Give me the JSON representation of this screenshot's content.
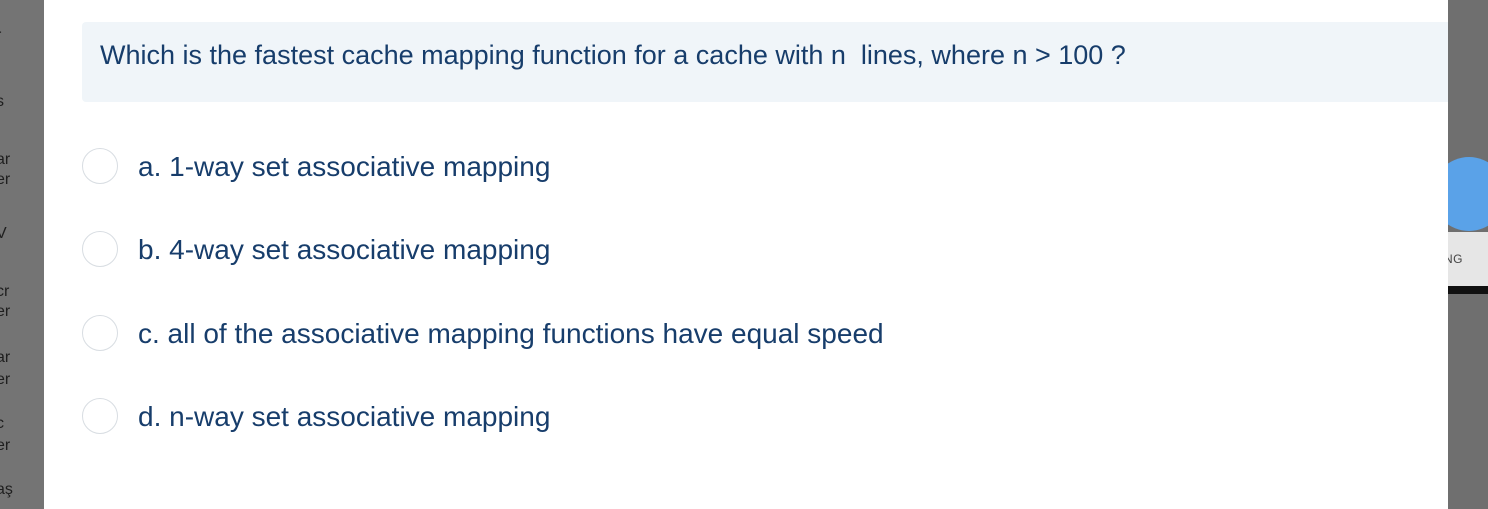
{
  "question": {
    "text": "Which is the fastest cache mapping function for a cache with n  lines, where n > 100 ?"
  },
  "options": [
    {
      "label": "a. 1-way set associative mapping",
      "selected": false
    },
    {
      "label": "b. 4-way set associative mapping",
      "selected": false
    },
    {
      "label": "c. all of the associative mapping functions have equal speed",
      "selected": false
    },
    {
      "label": "d. n-way set associative mapping",
      "selected": false
    }
  ],
  "right_side": {
    "bar_text": "NG"
  },
  "colors": {
    "question_text": "#173d6b",
    "question_bg": "#f0f5f9",
    "accent_fab": "#5aa2e8",
    "overlay": "#6f6f6f"
  }
}
